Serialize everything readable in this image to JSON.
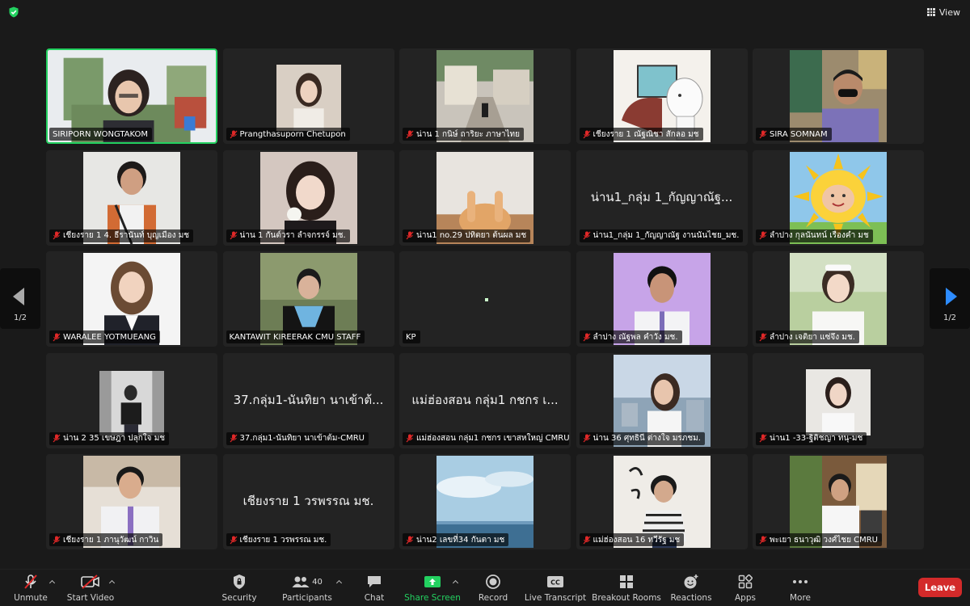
{
  "topbar": {
    "view_label": "View"
  },
  "pager": {
    "left": "1/2",
    "right": "1/2"
  },
  "tiles": [
    {
      "name": "SIRIPORN WONGTAKOM"
    },
    {
      "name": "Prangthasuporn Chetupon"
    },
    {
      "name": "น่าน 1 กนิษ์ ถาริยะ ภาษาไทย"
    },
    {
      "name": "เชียงราย 1 ณัฐณิชา สักลอ มช"
    },
    {
      "name": "SIRA SOMNAM"
    },
    {
      "name": "เชียงราย 1 4. ธีรานันท์ บุญเมือง มช"
    },
    {
      "name": "น่าน 1 กันต์วรา ลำจกรรจ์ มช."
    },
    {
      "name": "น่าน1 no.29 ปทิตยา ต้นผล มช"
    },
    {
      "name": "น่าน1_กลุ่ม 1_กัญญาณัฐ งานนันไชย_มช.",
      "center": "น่าน1_กลุ่ม 1_กัญญาณัฐ..."
    },
    {
      "name": "ลำปาง กุลนันทน์ เรืองคำ มช"
    },
    {
      "name": "WARALEE YOTMUEANG"
    },
    {
      "name": "KANTAWIT KIREERAK CMU STAFF"
    },
    {
      "name": "KP"
    },
    {
      "name": "ลำปาง ณัฐพล คำวัง มช."
    },
    {
      "name": "ลำปาง เจติยา แซ่จึง มช."
    },
    {
      "name": "น่าน 2 35 เขษฎา ปลุกใจ มช"
    },
    {
      "name": "37.กลุ่ม1-นันทิยา นาเข้าต้ม-CMRU",
      "center": "37.กลุ่ม1-นันทิยา นาเข้าต้..."
    },
    {
      "name": "แม่ฮ่องสอน กลุ่ม1 กชกร เขาสหใหญ่ CMRU",
      "center": "แม่ฮ่องสอน กลุ่ม1 กชกร เ..."
    },
    {
      "name": "น่าน 36 ศุทธินี ต่างใจ มรภชม."
    },
    {
      "name": "น่าน1 -33-ฐิติชญา ทนุ-มช"
    },
    {
      "name": "เชียงราย 1 ภานุวัฒน์ กาวิน"
    },
    {
      "name": "เชียงราย 1 วรพรรณ มช.",
      "center": "เชียงราย 1 วรพรรณ มช."
    },
    {
      "name": "น่าน2 เลขที่34 กันตา มช"
    },
    {
      "name": "แม่ฮ่องสอน 16 ทวีรัฐ มช"
    },
    {
      "name": "พะเยา ธนาวุฒิ วงศ์ไชย CMRU"
    }
  ],
  "toolbar": {
    "unmute": "Unmute",
    "start_video": "Start Video",
    "security": "Security",
    "participants": "Participants",
    "participants_count": "40",
    "chat": "Chat",
    "share_screen": "Share Screen",
    "record": "Record",
    "live_transcript": "Live Transcript",
    "breakout_rooms": "Breakout Rooms",
    "reactions": "Reactions",
    "apps": "Apps",
    "more": "More",
    "leave": "Leave"
  },
  "colors": {
    "active_speaker": "#23d160",
    "leave": "#d32a2a",
    "share": "#23d160",
    "accent": "#2d8cff"
  }
}
